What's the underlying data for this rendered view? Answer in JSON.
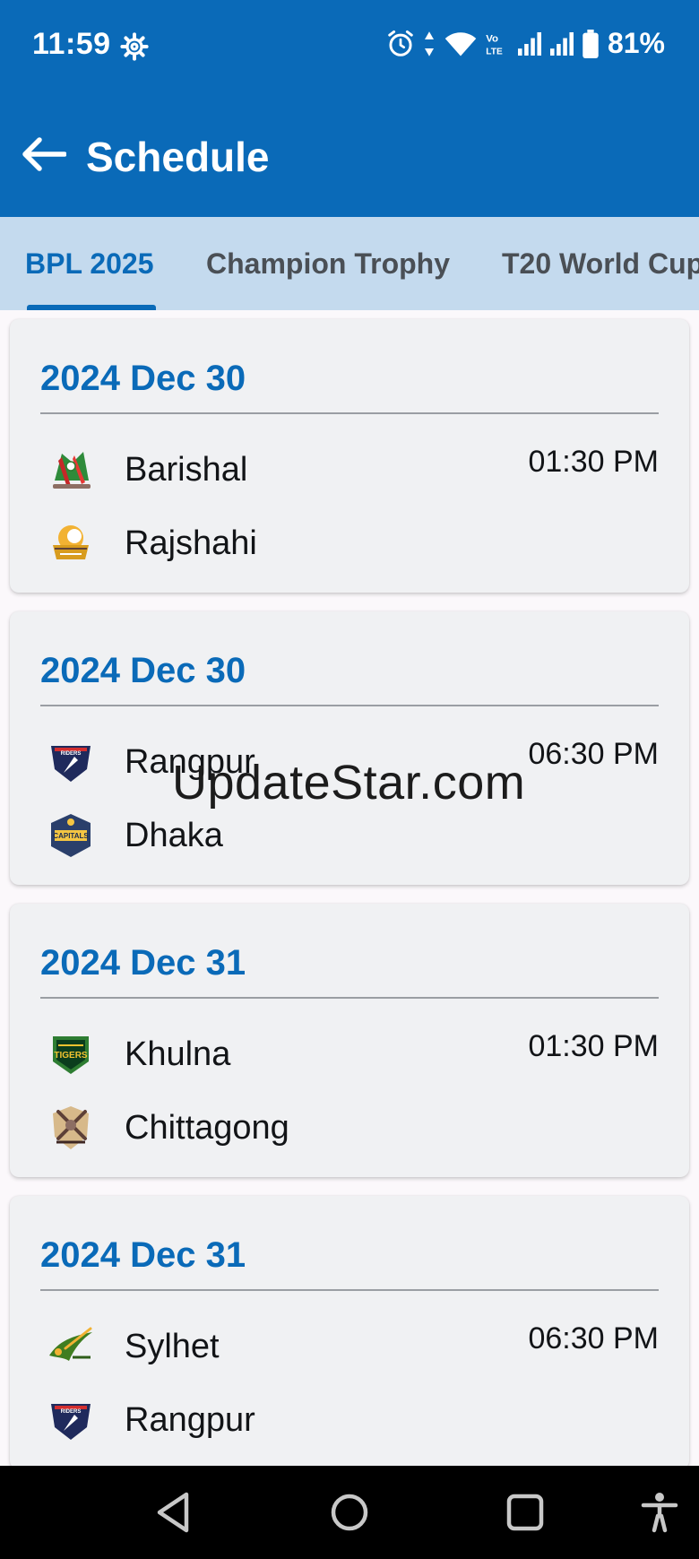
{
  "status_bar": {
    "time": "11:59",
    "battery_pct": "81%",
    "icons": [
      "gear-icon",
      "alarm-icon",
      "data-arrows-icon",
      "wifi-icon",
      "volte-icon",
      "signal-icon",
      "signal-icon",
      "battery-icon"
    ]
  },
  "app_bar": {
    "title": "Schedule",
    "back_icon": "arrow-left-icon"
  },
  "tabs": [
    {
      "label": "BPL 2025",
      "active": true
    },
    {
      "label": "Champion Trophy",
      "active": false
    },
    {
      "label": "T20 World Cup",
      "active": false
    }
  ],
  "matches": [
    {
      "date": "2024 Dec 30",
      "time": "01:30 PM",
      "team1": "Barishal",
      "team2": "Rajshahi"
    },
    {
      "date": "2024 Dec 30",
      "time": "06:30 PM",
      "team1": "Rangpur",
      "team2": "Dhaka"
    },
    {
      "date": "2024 Dec 31",
      "time": "01:30 PM",
      "team1": "Khulna",
      "team2": "Chittagong"
    },
    {
      "date": "2024 Dec 31",
      "time": "06:30 PM",
      "team1": "Sylhet",
      "team2": "Rangpur"
    }
  ],
  "watermark": "UpdateStar.com",
  "nav_bar": {
    "icons": [
      "back-triangle-icon",
      "home-circle-icon",
      "recents-square-icon",
      "accessibility-icon"
    ]
  },
  "colors": {
    "primary": "#0a6ab8",
    "tab_bar_bg": "#c4daee",
    "card_bg": "#f0f1f3"
  }
}
